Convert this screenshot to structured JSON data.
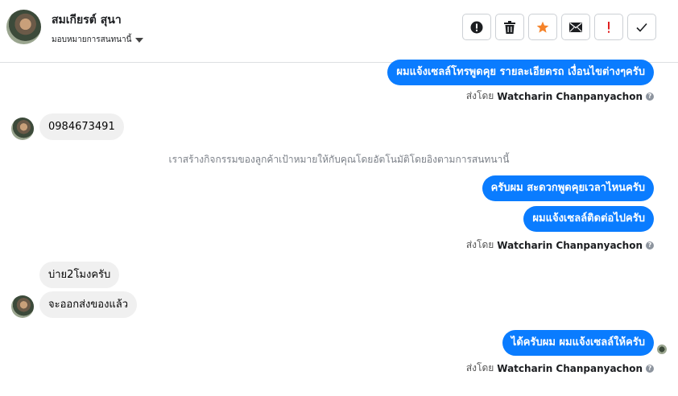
{
  "header": {
    "contact_name": "สมเกียรต์ สุนา",
    "assign_label": "มอบหมายการสนทนานี้",
    "toolbar": [
      {
        "name": "alert-icon"
      },
      {
        "name": "trash-icon"
      },
      {
        "name": "star-icon",
        "color": "#f5832a"
      },
      {
        "name": "mail-icon"
      },
      {
        "name": "exclamation-icon",
        "color": "#e02020"
      },
      {
        "name": "check-icon"
      }
    ]
  },
  "messages": {
    "out_1": "ผมแจ้งเซลล์โทรพูดคุย รายละเอียดรถ เงื่อนไขต่างๆครับ",
    "in_1": "0984673491",
    "system_note": "เราสร้างกิจกรรมของลูกค้าเป้าหมายให้กับคุณโดยอัตโนมัติโดยอิงตามการสนทนานี้",
    "out_2": "ครับผม สะดวกพูดคุยเวลาไหนครับ",
    "out_3": "ผมแจ้งเซลล์ติดต่อไปครับ",
    "in_2": "บ่าย2โมงครับ",
    "in_3": "จะออกส่งของแล้ว",
    "out_4": "ได้ครับผม ผมแจ้งเซลล์ให้ครับ"
  },
  "sent_by": {
    "prefix": "ส่งโดย",
    "agent": "Watcharin Chanpanyachon",
    "help": "?"
  },
  "colors": {
    "outgoing_bubble": "#0a7cff",
    "incoming_bubble": "#f0f0f0"
  }
}
